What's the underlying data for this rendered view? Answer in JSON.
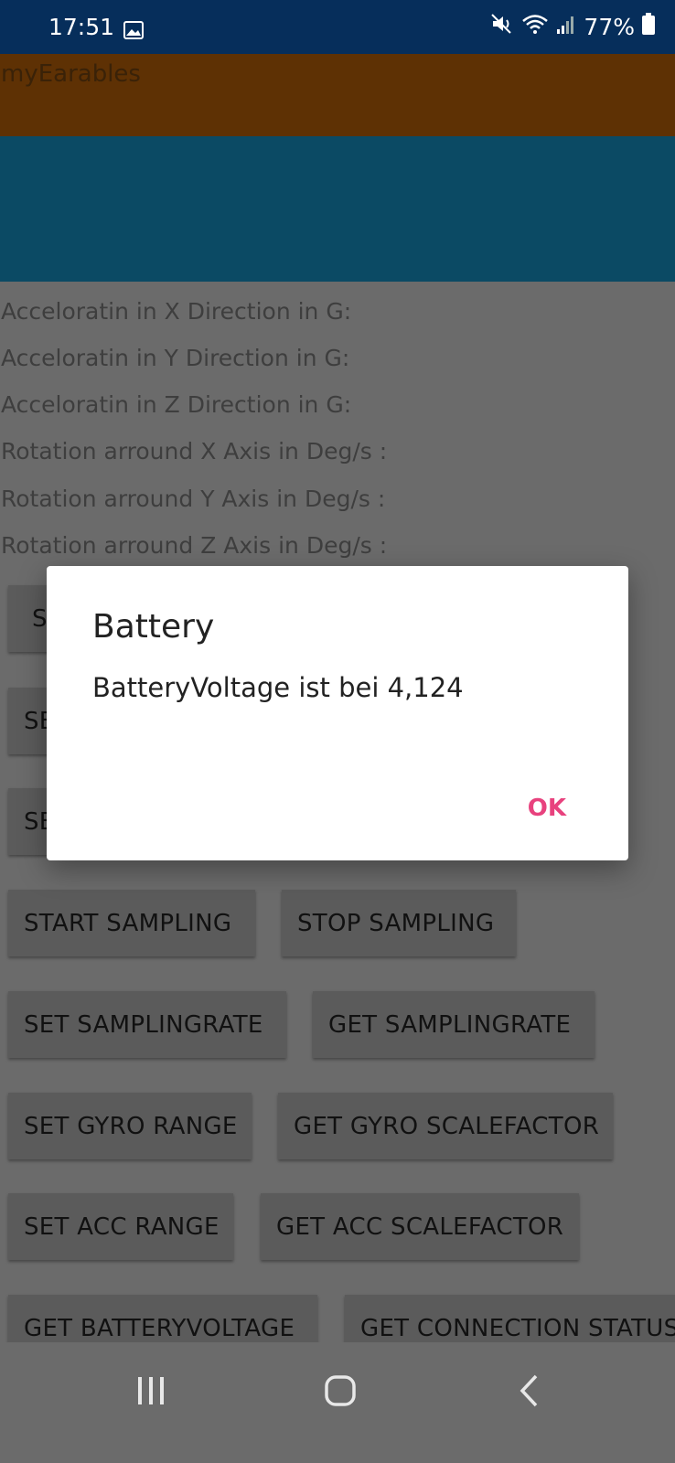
{
  "status_bar": {
    "time": "17:51",
    "battery_percent": "77%",
    "icons": [
      "image-icon",
      "mute-icon",
      "wifi-icon",
      "signal-icon",
      "battery-icon"
    ]
  },
  "app": {
    "title": "myEarables",
    "colors": {
      "title_bar": "#5e3104",
      "banner": "#0b4a64",
      "status_bar": "#062e5b",
      "ok": "#e8427e"
    }
  },
  "labels": [
    "Acceloratin in X Direction in G:",
    "Acceloratin in Y Direction in G:",
    "Acceloratin in Z Direction in G:",
    "Rotation arround X Axis in Deg/s :",
    "Rotation arround Y Axis in Deg/s :",
    "Rotation arround Z Axis in Deg/s :"
  ],
  "buttons": {
    "hidden_1": "S",
    "hidden_2": "SE",
    "hidden_3": "SE",
    "start_sampling": "START SAMPLING",
    "stop_sampling": "STOP SAMPLING",
    "set_samplingrate": "SET SAMPLINGRATE",
    "get_samplingrate": "GET SAMPLINGRATE",
    "set_gyro_range": "SET GYRO RANGE",
    "get_gyro_scalefactor": "GET GYRO SCALEFACTOR",
    "set_acc_range": "SET ACC RANGE",
    "get_acc_scalefactor": "GET ACC SCALEFACTOR",
    "get_batteryvoltage": "GET BATTERYVOLTAGE",
    "get_connection_status": "GET CONNECTION STATUS"
  },
  "dialog": {
    "title": "Battery",
    "message": "BatteryVoltage ist bei 4,124",
    "ok_label": "OK"
  },
  "nav_bar": {
    "icons": [
      "recent-apps-icon",
      "home-icon",
      "back-icon"
    ]
  }
}
